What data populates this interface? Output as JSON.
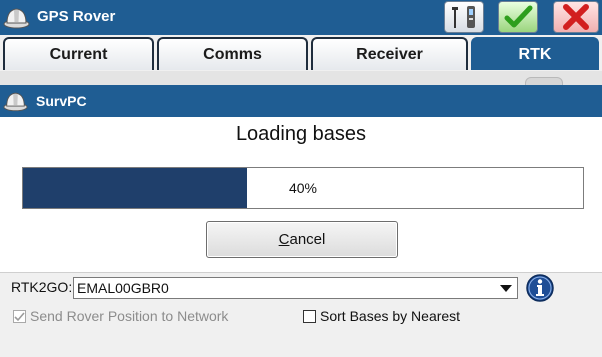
{
  "window": {
    "title": "GPS Rover",
    "icons": {
      "logo": "hardhat-icon",
      "tools": "instrument-icon",
      "ok": "checkmark-icon",
      "close": "x-icon"
    },
    "colors": {
      "accent": "#1f5d93",
      "ok": "#2e9e1d",
      "close": "#d21f1f"
    }
  },
  "tabs": [
    {
      "label": "Current",
      "active": false
    },
    {
      "label": "Comms",
      "active": false
    },
    {
      "label": "Receiver",
      "active": false
    },
    {
      "label": "RTK",
      "active": true
    }
  ],
  "dialog": {
    "title": "SurvPC",
    "heading": "Loading bases",
    "progress": {
      "percent": 40,
      "label": "40%"
    },
    "cancel_label": "Cancel"
  },
  "rtk": {
    "source_label": "RTK2GO:",
    "mountpoint": "EMAL00GBR0",
    "send_position_label": "Send Rover Position to Network",
    "send_position_checked": true,
    "send_position_enabled": false,
    "sort_label": "Sort Bases by Nearest",
    "sort_checked": false
  }
}
